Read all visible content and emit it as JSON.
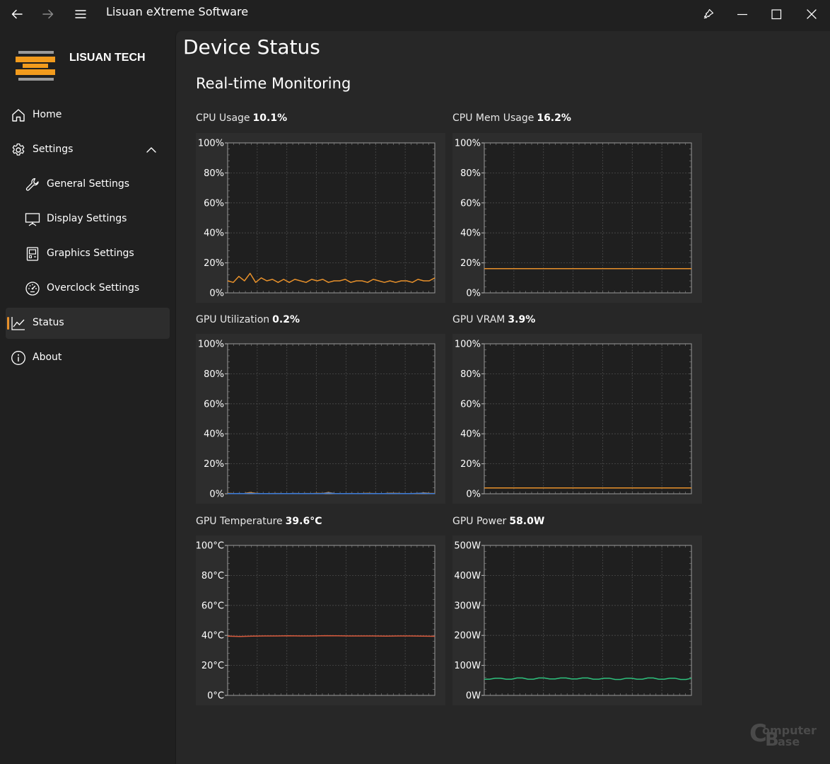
{
  "window": {
    "title": "Lisuan eXtreme Software"
  },
  "sidebar": {
    "brand": "LISUAN TECH",
    "items": [
      {
        "label": "Home",
        "icon": "home-icon"
      },
      {
        "label": "Settings",
        "icon": "gear-icon"
      },
      {
        "label": "General Settings",
        "icon": "wrench-icon"
      },
      {
        "label": "Display Settings",
        "icon": "display-icon"
      },
      {
        "label": "Graphics Settings",
        "icon": "graphics-card-icon"
      },
      {
        "label": "Overclock Settings",
        "icon": "gauge-icon"
      },
      {
        "label": "Status",
        "icon": "chart-icon"
      },
      {
        "label": "About",
        "icon": "info-icon"
      }
    ]
  },
  "main": {
    "page_title": "Device Status",
    "section_title": "Real-time Monitoring"
  },
  "metrics": [
    {
      "label": "CPU Usage",
      "value": "10.1%"
    },
    {
      "label": "CPU Mem Usage",
      "value": "16.2%"
    },
    {
      "label": "GPU Utilization",
      "value": "0.2%"
    },
    {
      "label": "GPU VRAM",
      "value": "3.9%"
    },
    {
      "label": "GPU Temperature",
      "value": "39.6°C"
    },
    {
      "label": "GPU Power",
      "value": "58.0W"
    }
  ],
  "watermark": "ComputerBase",
  "chart_data": [
    {
      "type": "line",
      "color": "#e8912b",
      "ylim": [
        0,
        100
      ],
      "yticks": [
        "100%",
        "80%",
        "60%",
        "40%",
        "20%",
        "0%"
      ],
      "series": [
        {
          "values": [
            8,
            7,
            11,
            8,
            13,
            7,
            10,
            8,
            9,
            7,
            9,
            7,
            9,
            8,
            7,
            9,
            8,
            9,
            7,
            8,
            8,
            9,
            7,
            8,
            8,
            7,
            9,
            8,
            7,
            8,
            7,
            8,
            8,
            7,
            9,
            8,
            8,
            10
          ]
        }
      ]
    },
    {
      "type": "line",
      "color": "#e8912b",
      "ylim": [
        0,
        100
      ],
      "yticks": [
        "100%",
        "80%",
        "60%",
        "40%",
        "20%",
        "0%"
      ],
      "series": [
        {
          "values": [
            16.2,
            16.2,
            16.2,
            16.2,
            16.2,
            16.2,
            16.2,
            16.2,
            16.2,
            16.2,
            16.2,
            16.2
          ]
        }
      ]
    },
    {
      "type": "line",
      "color": "#e8912b",
      "ylim": [
        0,
        100
      ],
      "yticks": [
        "100%",
        "80%",
        "60%",
        "40%",
        "20%",
        "0%"
      ],
      "series": [
        {
          "values": [
            0.4,
            0.2,
            0.1,
            0.2,
            0.8,
            0.3,
            0.1,
            0.1,
            0.2,
            0.2,
            0.1,
            0.1,
            0.2,
            0.1,
            0.2,
            0.1,
            0.3,
            0.2,
            0.9,
            0.2,
            0.1,
            0.1,
            0.2,
            0.1,
            0.2,
            0.3,
            0.2,
            0.1,
            0.1,
            0.4,
            0.3,
            0.2,
            0.1,
            0.2,
            0.1,
            0.6,
            0.3,
            0.2
          ]
        },
        {
          "values": [
            0.1,
            0.1,
            0.2,
            0.1,
            0.3,
            0.1,
            0.1,
            0.1,
            0.1,
            0.1,
            0.1,
            0.1,
            0.2,
            0.1,
            0.1,
            0.1,
            0.1,
            0.1,
            0.5,
            0.2,
            0.1,
            0.1,
            0.1,
            0.1,
            0.1,
            0.1,
            0.1,
            0.1,
            0.1,
            0.2,
            0.2,
            0.1,
            0.1,
            0.1,
            0.3,
            0.4,
            0.2,
            0.1
          ],
          "color": "#3d7ddc"
        }
      ]
    },
    {
      "type": "line",
      "color": "#e8912b",
      "ylim": [
        0,
        100
      ],
      "yticks": [
        "100%",
        "80%",
        "60%",
        "40%",
        "20%",
        "0%"
      ],
      "series": [
        {
          "values": [
            3.9,
            3.9,
            3.9,
            3.9,
            3.9,
            3.9,
            3.9,
            3.9,
            3.9,
            3.9,
            3.9,
            3.9
          ]
        }
      ]
    },
    {
      "type": "line",
      "color": "#d85a3c",
      "ylim": [
        0,
        100
      ],
      "yticks": [
        "100°C",
        "80°C",
        "60°C",
        "40°C",
        "20°C",
        "0°C"
      ],
      "series": [
        {
          "values": [
            39.5,
            39.3,
            39.5,
            39.6,
            39.6,
            39.7,
            39.6,
            39.6,
            39.8,
            39.7,
            39.6,
            39.6,
            39.6,
            39.5,
            39.6,
            39.6,
            39.5,
            39.4
          ]
        }
      ]
    },
    {
      "type": "line",
      "color": "#2ec27e",
      "ylim": [
        0,
        500
      ],
      "yticks": [
        "500W",
        "400W",
        "300W",
        "200W",
        "100W",
        "0W"
      ],
      "series": [
        {
          "values": [
            54,
            54,
            57,
            57,
            54,
            54,
            58,
            58,
            54,
            54,
            58,
            58,
            55,
            55,
            58,
            58,
            55,
            55,
            58,
            58,
            54,
            54,
            57,
            57,
            53,
            53,
            57,
            57,
            54,
            54,
            58,
            58,
            54,
            54,
            57,
            57,
            53,
            53,
            57
          ]
        }
      ]
    }
  ]
}
